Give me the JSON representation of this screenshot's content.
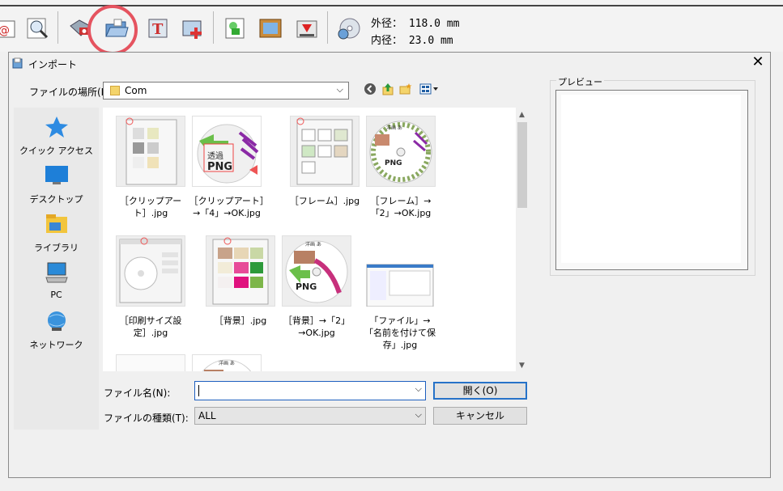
{
  "toolbar": {
    "outer_label": "外径：",
    "outer_value": "118.0 mm",
    "inner_label": "内径：",
    "inner_value": "23.0 mm"
  },
  "dialog": {
    "title": "インポート",
    "close_glyph": "✕",
    "location_label": "ファイルの場所(I):",
    "location_value": "Com",
    "places": [
      "クイック アクセス",
      "デスクトップ",
      "ライブラリ",
      "PC",
      "ネットワーク"
    ],
    "files": [
      {
        "name": "［クリップアート］.jpg"
      },
      {
        "name": "［クリップアート］→「4」→OK.jpg"
      },
      {
        "name": "［フレーム］.jpg"
      },
      {
        "name": "［フレーム］→「2」→OK.jpg"
      },
      {
        "name": "［印刷サイズ設定］.jpg"
      },
      {
        "name": "［背景］.jpg"
      },
      {
        "name": "［背景］→「2」→OK.jpg"
      },
      {
        "name": "「ファイル」→「名前を付けて保存」.jpg"
      }
    ],
    "filename_label": "ファイル名(N):",
    "filename_value": "",
    "filetype_label": "ファイルの種類(T):",
    "filetype_value": "ALL",
    "open_label": "開く(O)",
    "cancel_label": "キャンセル",
    "preview_label": "プレビュー"
  },
  "colors": {
    "accent": "#2672c8",
    "highlight_circle": "#e5535f"
  }
}
